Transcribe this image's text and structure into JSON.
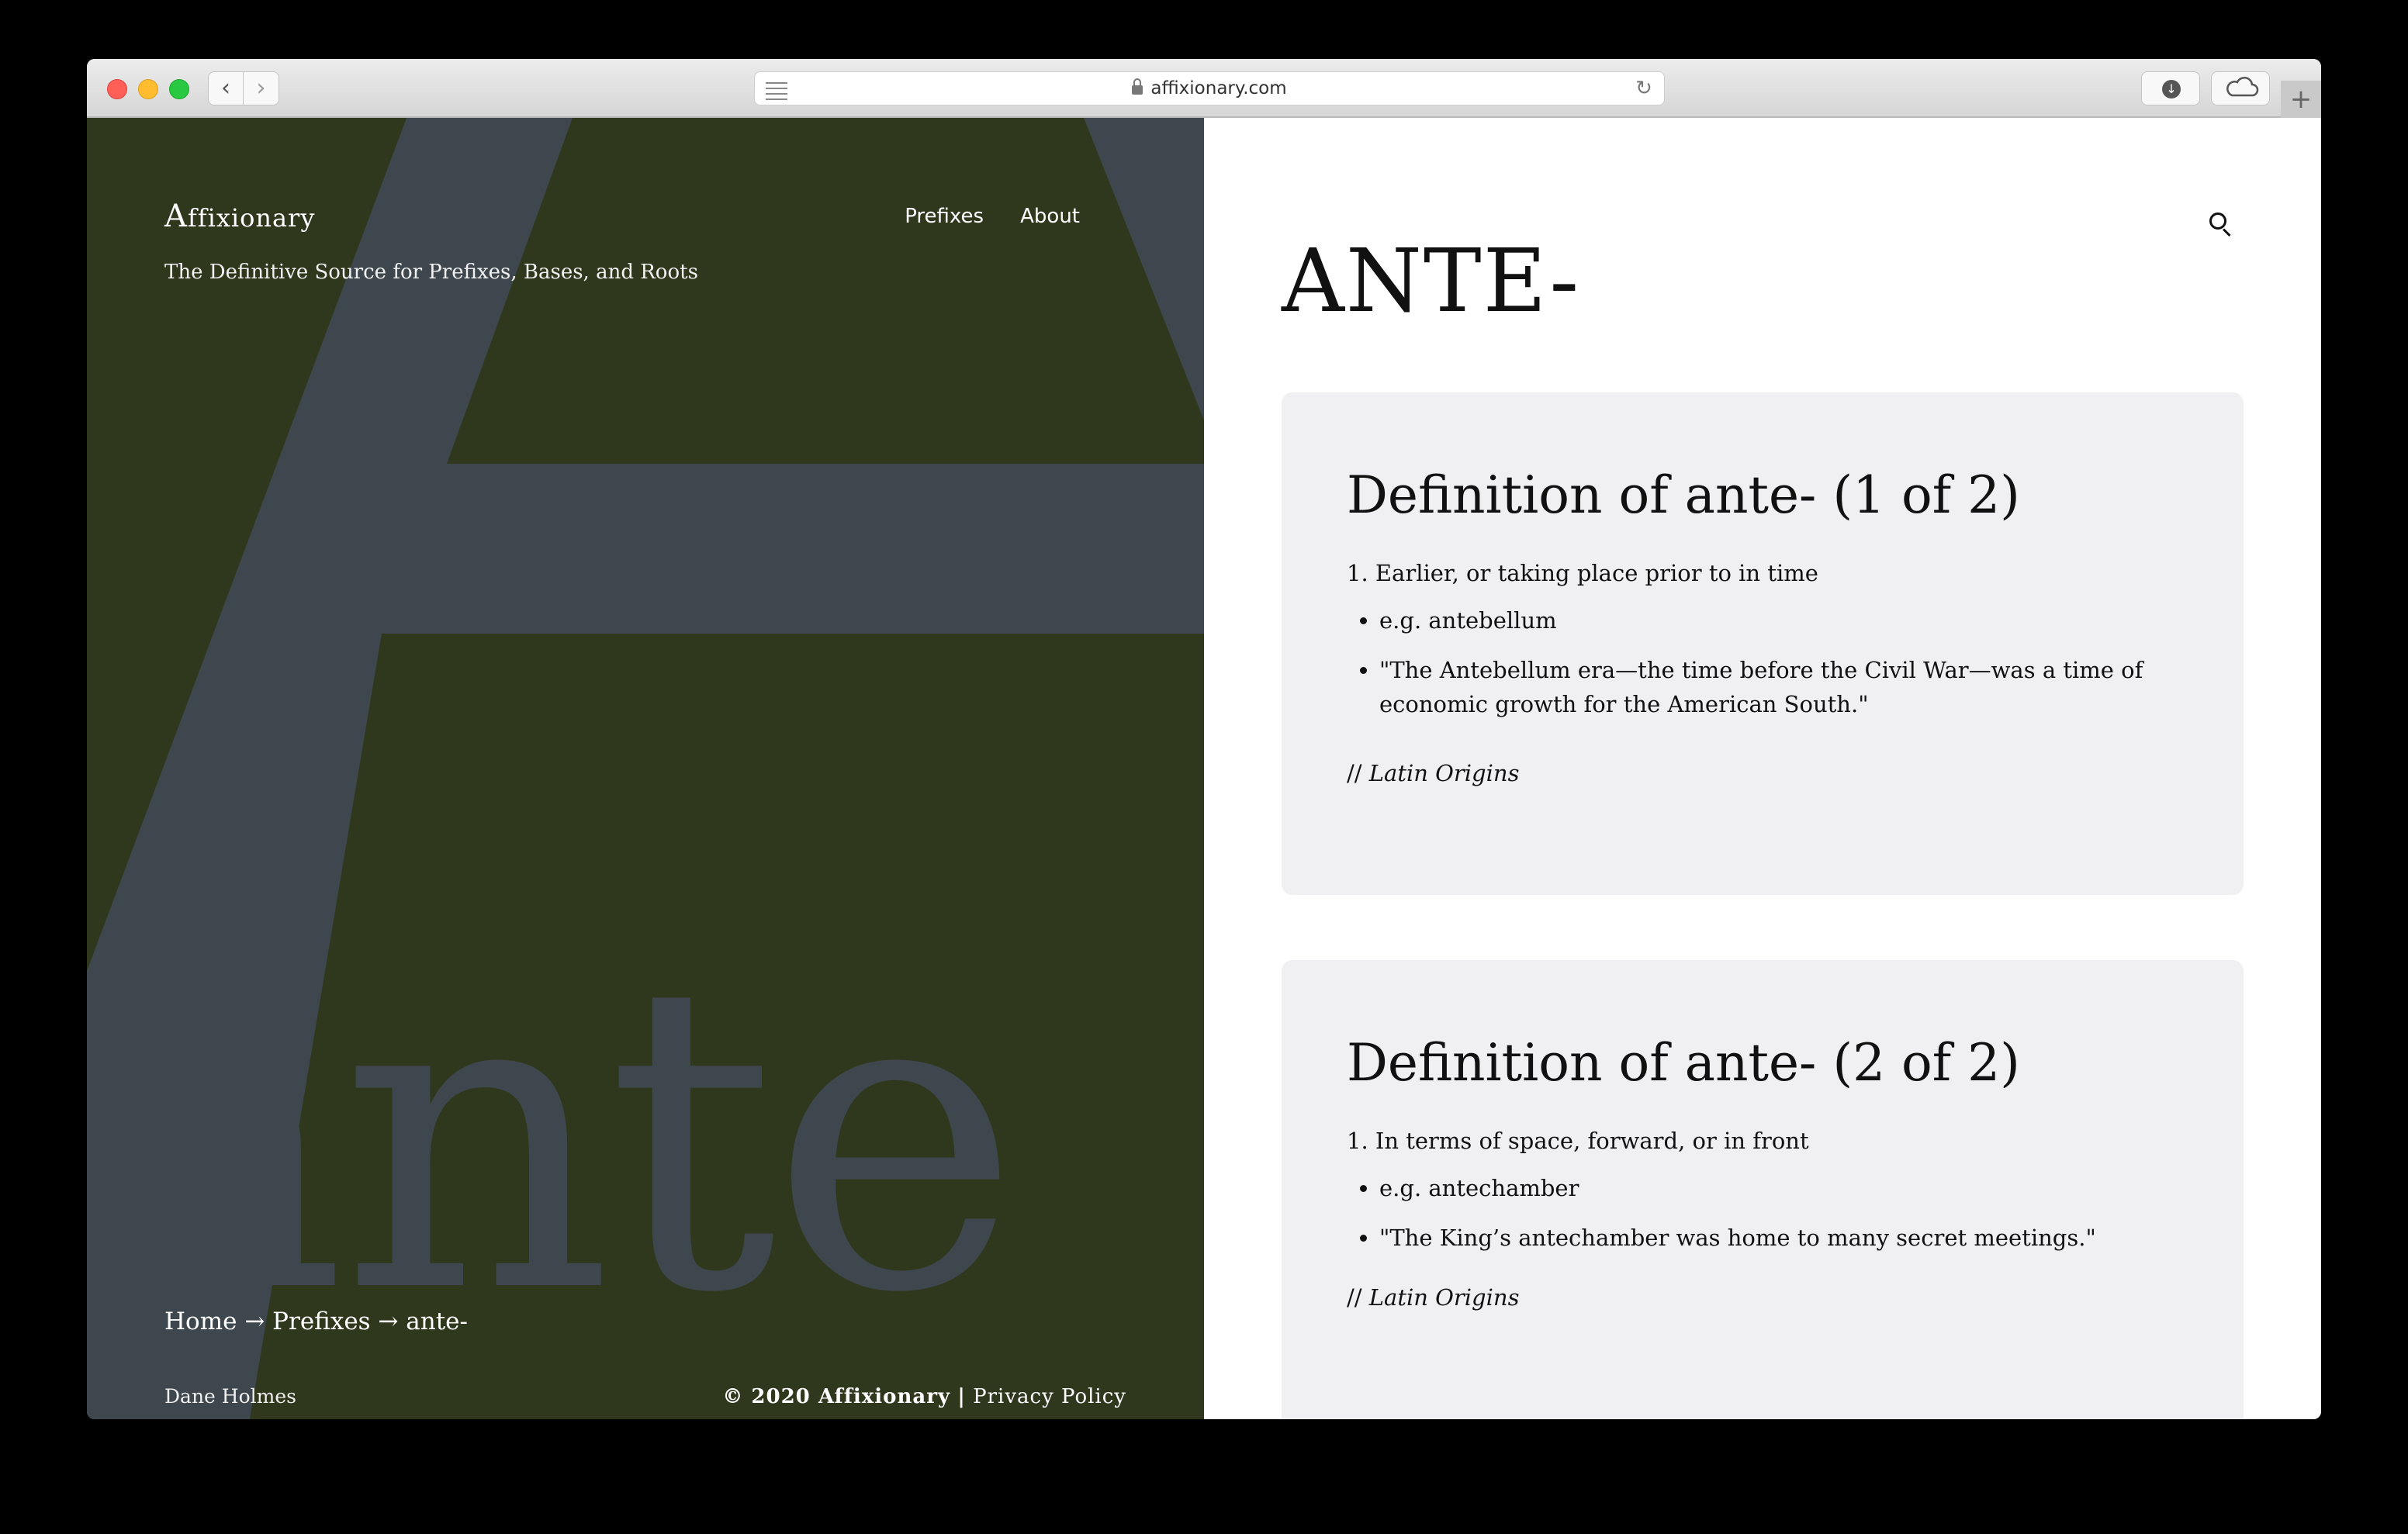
{
  "browser": {
    "url": "affixionary.com",
    "new_tab_symbol": "+"
  },
  "site": {
    "brand": {
      "first": "A",
      "rest": "ffixionary"
    },
    "tagline": "The Definitive Source for Prefixes, Bases, and Roots",
    "nav": [
      "Prefixes",
      "About"
    ],
    "hero_word": "ante",
    "breadcrumb": {
      "items": [
        "Home",
        "Prefixes",
        "ante-"
      ],
      "separator": " → "
    },
    "author": "Dane Holmes",
    "footer": {
      "copyright": "© 2020 Affixionary",
      "divider": "|",
      "privacy_link": "Privacy Policy"
    }
  },
  "entry": {
    "title": "ANTE-",
    "definitions": [
      {
        "heading": "Definition of ante- (1 of 2)",
        "sense": "1. Earlier, or taking place prior to in time",
        "bullets": [
          "e.g. antebellum",
          "\"The Antebellum era—the time before the Civil War—was a time of economic growth for the American South.\""
        ],
        "origin_prefix": "//",
        "origin": "Latin Origins"
      },
      {
        "heading": "Definition of ante- (2 of 2)",
        "sense": "1. In terms of space, forward, or in front",
        "bullets": [
          "e.g. antechamber",
          "\"The King’s antechamber was home to many secret meetings.\""
        ],
        "origin_prefix": "//",
        "origin": "Latin Origins"
      }
    ]
  },
  "colors": {
    "hero_bg": "#2f371d",
    "hero_glyph": "#3e474d",
    "card_bg": "#f0f0f2"
  }
}
